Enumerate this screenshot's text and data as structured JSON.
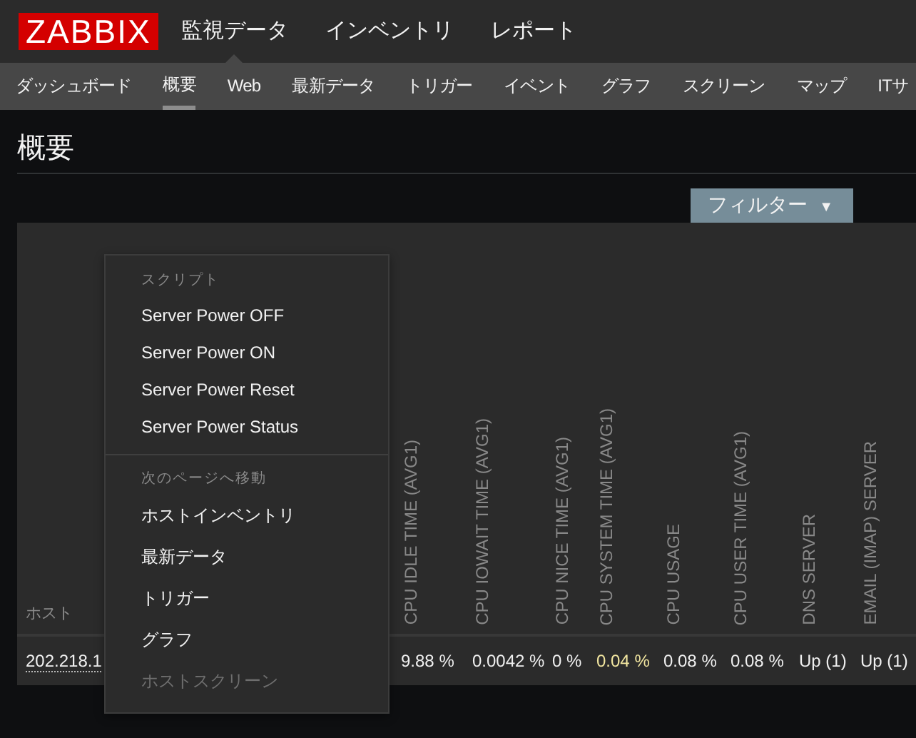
{
  "logo": "ZABBIX",
  "main_menu": [
    {
      "label": "監視データ",
      "selected": true
    },
    {
      "label": "インベントリ",
      "selected": false
    },
    {
      "label": "レポート",
      "selected": false
    }
  ],
  "sub_menu": [
    {
      "label": "ダッシュボード",
      "selected": false
    },
    {
      "label": "概要",
      "selected": true
    },
    {
      "label": "Web",
      "selected": false
    },
    {
      "label": "最新データ",
      "selected": false
    },
    {
      "label": "トリガー",
      "selected": false
    },
    {
      "label": "イベント",
      "selected": false
    },
    {
      "label": "グラフ",
      "selected": false
    },
    {
      "label": "スクリーン",
      "selected": false
    },
    {
      "label": "マップ",
      "selected": false
    },
    {
      "label": "ITサ",
      "selected": false
    }
  ],
  "page_title": "概要",
  "filter_button": {
    "label": "フィルター",
    "caret": "▼"
  },
  "table": {
    "host_header": "ホスト",
    "host": "202.218.1",
    "columns": [
      {
        "header": "CPU IDLE TIME (AVG1)",
        "value": "9.88 %",
        "color": "#f0f0f0"
      },
      {
        "header": "CPU IOWAIT TIME (AVG1)",
        "value": "0.0042 %",
        "color": "#f0f0f0"
      },
      {
        "header": "CPU NICE TIME (AVG1)",
        "value": "0 %",
        "color": "#f0f0f0"
      },
      {
        "header": "CPU SYSTEM TIME (AVG1)",
        "value": "0.04 %",
        "color": "#f2e6a0"
      },
      {
        "header": "CPU USAGE",
        "value": "0.08 %",
        "color": "#f0f0f0"
      },
      {
        "header": "CPU USER TIME (AVG1)",
        "value": "0.08 %",
        "color": "#f0f0f0"
      },
      {
        "header": "DNS SERVER",
        "value": "Up (1)",
        "color": "#f0f0f0"
      },
      {
        "header": "EMAIL (IMAP) SERVER",
        "value": "Up (1)",
        "color": "#f0f0f0"
      }
    ]
  },
  "context_menu": {
    "sections": [
      {
        "title": "スクリプト",
        "items": [
          {
            "label": "Server Power OFF",
            "disabled": false
          },
          {
            "label": "Server Power ON",
            "disabled": false
          },
          {
            "label": "Server Power Reset",
            "disabled": false
          },
          {
            "label": "Server Power Status",
            "disabled": false
          }
        ]
      },
      {
        "title": "次のページへ移動",
        "items": [
          {
            "label": "ホストインベントリ",
            "disabled": false
          },
          {
            "label": "最新データ",
            "disabled": false
          },
          {
            "label": "トリガー",
            "disabled": false
          },
          {
            "label": "グラフ",
            "disabled": false
          },
          {
            "label": "ホストスクリーン",
            "disabled": true
          }
        ]
      }
    ]
  }
}
